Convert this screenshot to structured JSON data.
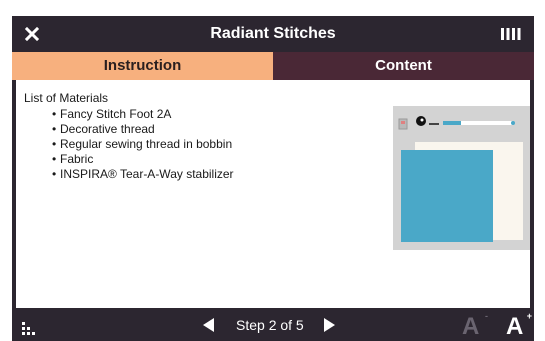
{
  "window": {
    "title": "Radiant Stitches",
    "close_icon": "close-icon",
    "menu_icon": "menu-bars-icon"
  },
  "tabs": [
    {
      "label": "Instruction",
      "active": true
    },
    {
      "label": "Content",
      "active": false
    }
  ],
  "instruction": {
    "list_title": "List of Materials",
    "items": [
      "Fancy Stitch Foot 2A",
      "Decorative thread",
      "Regular sewing thread in bobbin",
      "Fabric",
      "INSPIRA® Tear-A-Way stabilizer"
    ],
    "bullet": "•"
  },
  "footer": {
    "step_label": "Step 2 of 5",
    "prev_icon": "triangle-left-icon",
    "next_icon": "triangle-right-icon",
    "grid_icon": "grid-dots-icon",
    "font_smaller": {
      "glyph": "A",
      "mark": "-"
    },
    "font_larger": {
      "glyph": "A",
      "mark": "+"
    }
  },
  "colors": {
    "bar": "#2c2630",
    "tab_active": "#f7b07e",
    "tab_inactive": "#4a2836",
    "illustration_blue": "#4aa8c8",
    "illustration_bg": "#d3d3d3",
    "font_smaller_dim": "#6a6470"
  }
}
